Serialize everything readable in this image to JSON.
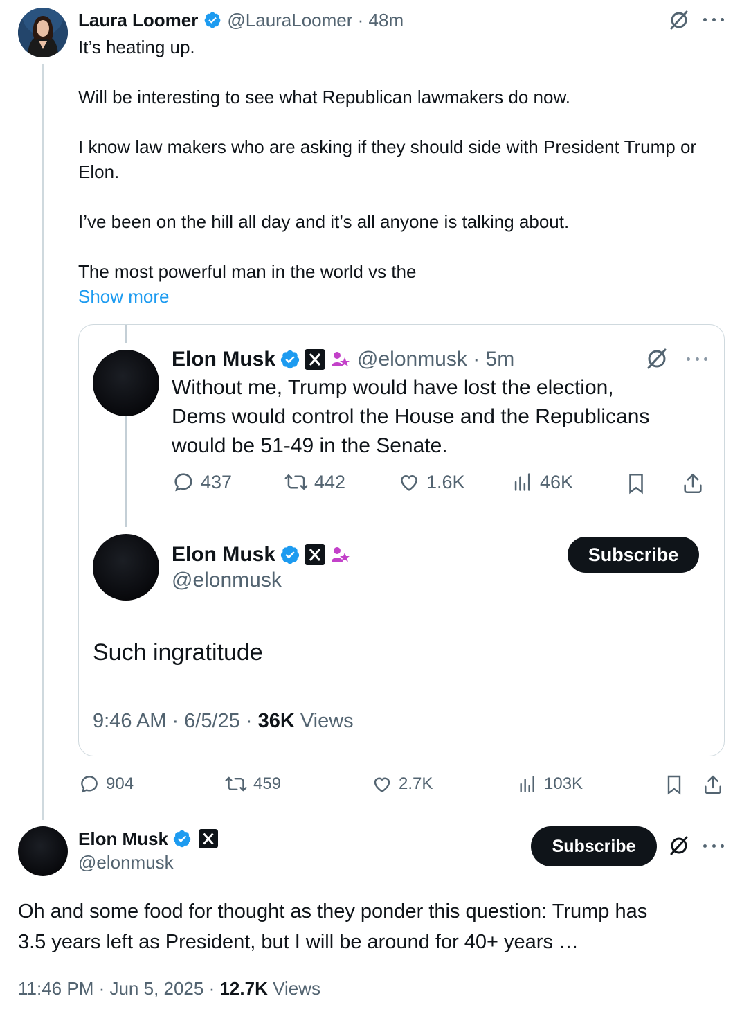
{
  "main_post": {
    "author_name": "Laura Loomer",
    "handle_time": "@LauraLoomer · 48m",
    "paragraphs": [
      "It’s heating up.",
      "Will be interesting to see what Republican lawmakers do now.",
      "I know law makers who are asking if they should side with President Trump or Elon.",
      "I’ve been on the hill all day and it’s all anyone is talking about.",
      "The most powerful man in the world vs the"
    ],
    "show_more": "Show more",
    "stats": {
      "replies": "904",
      "reposts": "459",
      "likes": "2.7K",
      "views": "103K"
    }
  },
  "quoted": {
    "first": {
      "author_name": "Elon Musk",
      "handle_time": "@elonmusk · 5m",
      "text_lines": [
        "Without me, Trump would have lost the election,",
        "Dems would control the House and the Republicans",
        "would be 51-49 in the Senate."
      ],
      "stats": {
        "replies": "437",
        "reposts": "442",
        "likes": "1.6K",
        "views": "46K"
      }
    },
    "second": {
      "author_name": "Elon Musk",
      "handle": "@elonmusk",
      "subscribe": "Subscribe",
      "text": "Such ingratitude",
      "timestamp": "9:46 AM · 6/5/25 · ",
      "views_count": "36K",
      "views_label": " Views"
    }
  },
  "reply": {
    "author_name": "Elon Musk",
    "handle": "@elonmusk",
    "subscribe": "Subscribe",
    "text_lines": [
      "Oh and some food for thought as they ponder this question: Trump has",
      "3.5 years left as President, but I will be around for 40+ years …"
    ],
    "timestamp": "11:46 PM · Jun 5, 2025 · ",
    "views_count": "12.7K",
    "views_label": " Views"
  },
  "colors": {
    "link": "#1d9bf0",
    "verified": "#1d9bf0",
    "text": "#0f1419",
    "muted": "#536471",
    "affiliate": "#c341c9"
  }
}
